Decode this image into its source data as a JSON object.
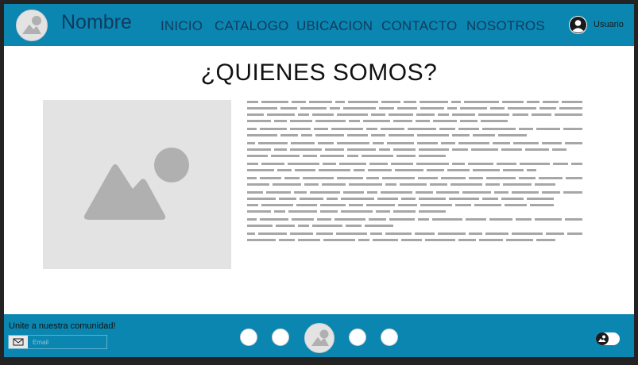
{
  "header": {
    "brand": "Nombre",
    "nav": [
      "INICIO",
      "CATALOGO",
      "UBICACION",
      "CONTACTO",
      "NOSOTROS"
    ],
    "user_label": "Usuario"
  },
  "main": {
    "title": "¿QUIENES SOMOS?",
    "image_icon": "image-placeholder-icon"
  },
  "footer": {
    "community_label": "Unite a nuestra comunidad!",
    "email_placeholder": "Email",
    "social_icons": [
      "social-icon",
      "social-icon",
      "social-icon",
      "social-icon"
    ],
    "toggle_icon": "theme-toggle-icon"
  },
  "colors": {
    "primary": "#0a86b0",
    "nav_text": "#133a5f",
    "placeholder": "#e3e3e3",
    "placeholder_icon": "#b0b0b0",
    "text_lines": "#a7a7a7"
  }
}
